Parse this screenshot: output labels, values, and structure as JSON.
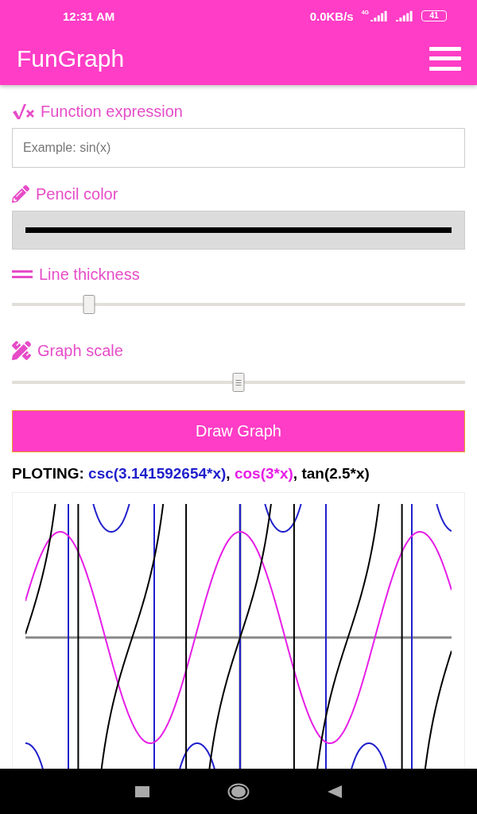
{
  "status_bar": {
    "time": "12:31 AM",
    "speed": "0.0KB/s",
    "network": "4G",
    "battery": "41"
  },
  "app_bar": {
    "title": "FunGraph"
  },
  "function_expression": {
    "label": "Function expression",
    "placeholder": "Example: sin(x)"
  },
  "pencil_color": {
    "label": "Pencil color",
    "color": "#000000"
  },
  "line_thickness": {
    "label": "Line thickness",
    "level": 0.17
  },
  "graph_scale": {
    "label": "Graph scale",
    "level": 0.5
  },
  "draw_button": "Draw Graph",
  "plotting": {
    "label": "PLOTING:",
    "separator": ", ",
    "functions": [
      {
        "text": "csc(3.141592654*x)",
        "color": "#1f1fcc"
      },
      {
        "text": "cos(3*x)",
        "color": "#e61ee6"
      },
      {
        "text": "tan(2.5*x)",
        "color": "#000000"
      }
    ]
  }
}
